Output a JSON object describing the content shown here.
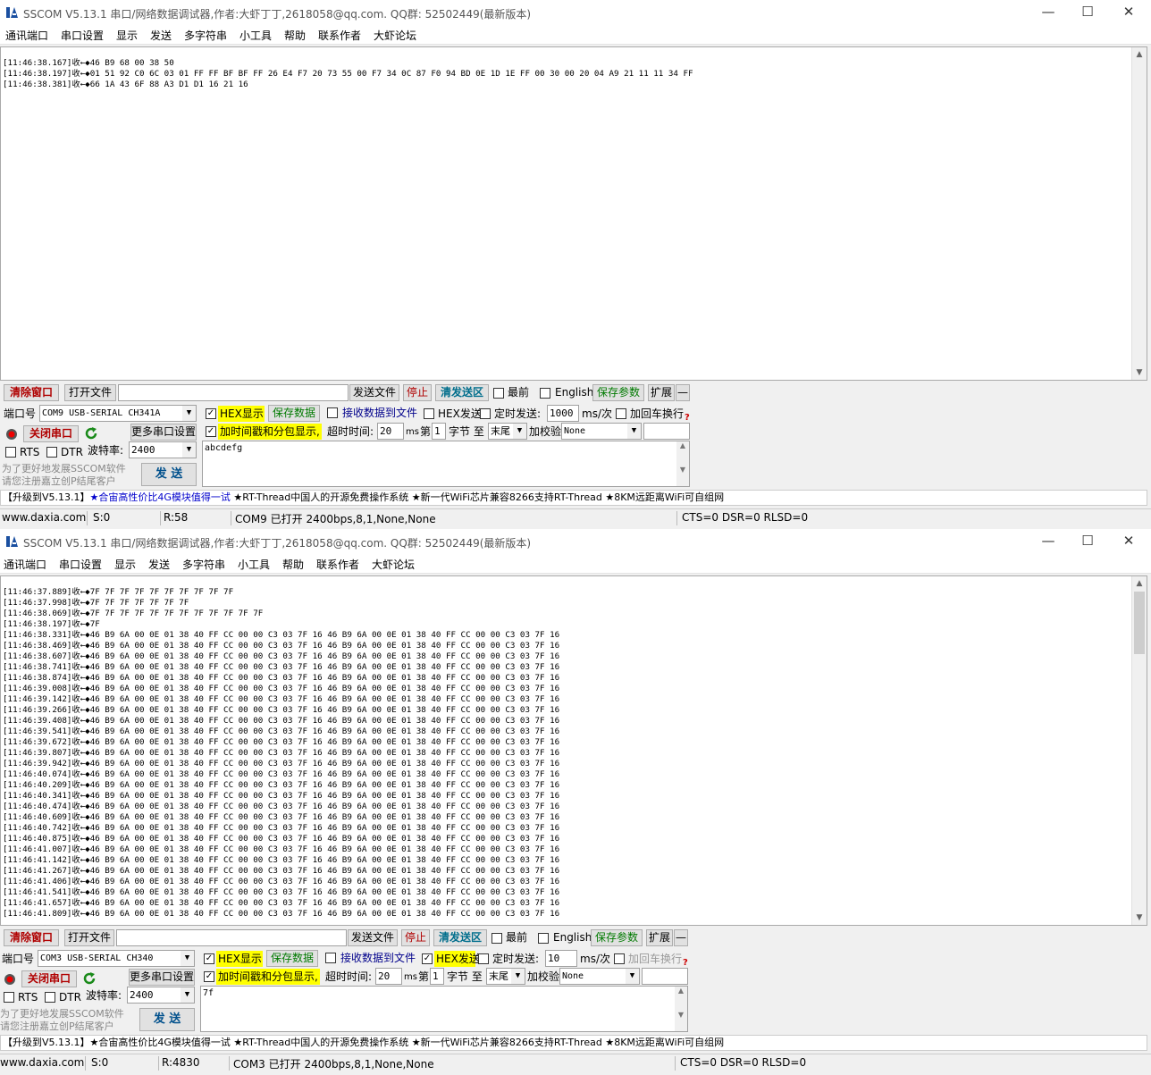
{
  "app": {
    "title": "SSCOM V5.13.1 串口/网络数据调试器,作者:大虾丁丁,2618058@qq.com. QQ群: 52502449(最新版本)",
    "window_controls": {
      "minimize": "—",
      "maximize": "☐",
      "close": "✕"
    },
    "menu": [
      "通讯端口",
      "串口设置",
      "显示",
      "发送",
      "多字符串",
      "小工具",
      "帮助",
      "联系作者",
      "大虾论坛"
    ]
  },
  "common": {
    "clear_window": "清除窗口",
    "open_file": "打开文件",
    "send_file": "发送文件",
    "stop": "停止",
    "clear_send": "清发送区",
    "topmost": "最前",
    "english": "English",
    "save_params": "保存参数",
    "expand": "扩展",
    "collapse": "—",
    "port_label": "端口号",
    "hex_display": "HEX显示",
    "save_data": "保存数据",
    "recv_to_file": "接收数据到文件",
    "hex_send": "HEX发送",
    "timed_send": "定时发送:",
    "ms_per": "ms/次",
    "add_crlf": "加回车换行",
    "help_q": "?",
    "timestamp_split": "加时间戳和分包显示,",
    "timeout_label": "超时时间:",
    "ms": "ms",
    "nth": "第",
    "byte_label": "字节 至",
    "checksum_label": "加校验",
    "more_settings": "更多串口设置",
    "rts": "RTS",
    "dtr": "DTR",
    "baud_label": "波特率:",
    "promo_line1": "为了更好地发展SSCOM软件",
    "promo_line2": "请您注册嘉立创P结尾客户",
    "send": "发 送",
    "ad_prefix": "【升级到V5.13.1】",
    "ad_link": "★合宙高性价比4G模块值得一试",
    "ad_rest": "★RT-Thread中国人的开源免费操作系统 ★新一代WiFi芯片兼容8266支持RT-Thread ★8KM远距离WiFi可自组网",
    "site": "www.daxia.com"
  },
  "window1": {
    "recv_lines": [
      "[11:46:38.167]收←◆46 B9 68 00 38 50",
      "[11:46:38.197]收←◆01 51 92 C0 6C 03 01 FF FF BF BF FF 26 E4 F7 20 73 55 00 F7 34 0C 87 F0 94 BD 0E 1D 1E FF 00 30 00 20 04 A9 21 11 11 34 FF",
      "[11:46:38.381]收←◆66 1A 43 6F 88 A3 D1 D1 16 21 16"
    ],
    "port": "COM9 USB-SERIAL CH341A",
    "close_port": "关闭串口",
    "hex_display_checked": true,
    "hex_send_checked": false,
    "timed_send_checked": false,
    "add_crlf_checked": false,
    "timestamp_checked": true,
    "timed_interval": "1000",
    "timeout": "20",
    "nth_value": "1",
    "end_select": "末尾",
    "checksum": "None",
    "baud": "2400",
    "send_text": "abcdefg",
    "status": {
      "s": "S:0",
      "r": "R:58",
      "port_info": "COM9 已打开  2400bps,8,1,None,None",
      "lines": "CTS=0 DSR=0 RLSD=0"
    }
  },
  "window2": {
    "recv_head": [
      "[11:46:37.889]收←◆7F 7F 7F 7F 7F 7F 7F 7F 7F 7F",
      "[11:46:37.998]收←◆7F 7F 7F 7F 7F 7F 7F",
      "[11:46:38.069]收←◆7F 7F 7F 7F 7F 7F 7F 7F 7F 7F 7F 7F",
      "[11:46:38.197]收←◆7F"
    ],
    "recv_repeat_payload": "46 B9 6A 00 0E 01 38 40 FF CC 00 00 C3 03 7F 16 46 B9 6A 00 0E 01 38 40 FF CC 00 00 C3 03 7F 16",
    "recv_timestamps": [
      "11:46:38.331",
      "11:46:38.469",
      "11:46:38.607",
      "11:46:38.741",
      "11:46:38.874",
      "11:46:39.008",
      "11:46:39.142",
      "11:46:39.266",
      "11:46:39.408",
      "11:46:39.541",
      "11:46:39.672",
      "11:46:39.807",
      "11:46:39.942",
      "11:46:40.074",
      "11:46:40.209",
      "11:46:40.341",
      "11:46:40.474",
      "11:46:40.609",
      "11:46:40.742",
      "11:46:40.875",
      "11:46:41.007",
      "11:46:41.142",
      "11:46:41.267",
      "11:46:41.406",
      "11:46:41.541",
      "11:46:41.657",
      "11:46:41.809"
    ],
    "port": "COM3 USB-SERIAL CH340",
    "close_port": "关闭串口",
    "hex_display_checked": true,
    "hex_send_checked": true,
    "timed_send_checked": false,
    "add_crlf_checked": false,
    "timestamp_checked": true,
    "timed_interval": "10",
    "timeout": "20",
    "nth_value": "1",
    "end_select": "末尾",
    "checksum": "None",
    "baud": "2400",
    "send_text": "7f",
    "status": {
      "s": "S:0",
      "r": "R:4830",
      "port_info": "COM3 已打开  2400bps,8,1,None,None",
      "lines": "CTS=0 DSR=0 RLSD=0"
    }
  },
  "colors": {
    "accent_red": "#b00000",
    "hex_highlight": "#ffff00",
    "save_green": "#007a00",
    "clear_send_teal": "#006e8c",
    "ad_blue": "#0000cc"
  }
}
